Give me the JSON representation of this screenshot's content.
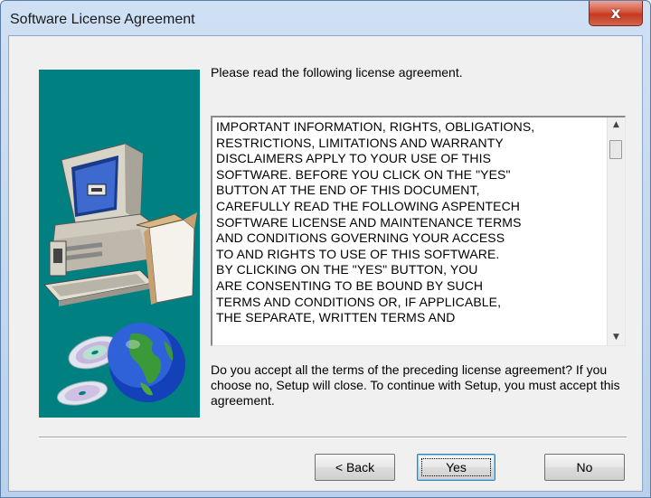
{
  "window": {
    "title": "Software License Agreement",
    "close_label": "x"
  },
  "prompt": "Please read the following license agreement.",
  "license": {
    "text": "IMPORTANT INFORMATION, RIGHTS, OBLIGATIONS,\nRESTRICTIONS, LIMITATIONS AND WARRANTY\nDISCLAIMERS APPLY TO YOUR USE OF THIS\nSOFTWARE.  BEFORE YOU CLICK ON THE \"YES\"\nBUTTON AT THE END OF THIS DOCUMENT,\nCAREFULLY READ THE FOLLOWING ASPENTECH\nSOFTWARE LICENSE AND MAINTENANCE TERMS\nAND CONDITIONS GOVERNING YOUR ACCESS\nTO AND RIGHTS TO USE OF THIS SOFTWARE.\nBY CLICKING ON THE \"YES\" BUTTON, YOU\nARE CONSENTING TO BE BOUND BY SUCH\nTERMS AND CONDITIONS OR, IF APPLICABLE,\nTHE SEPARATE, WRITTEN TERMS AND",
    "scroll_up_icon": "triangle-up-icon",
    "scroll_down_icon": "triangle-down-icon"
  },
  "question": "Do you accept all the terms of the preceding license agreement? If you choose no, Setup will close.  To continue with Setup, you must accept this agreement.",
  "buttons": {
    "back": "< Back",
    "yes": "Yes",
    "no": "No"
  },
  "colors": {
    "art_background": "#008080",
    "close_button": "#c94a31"
  }
}
